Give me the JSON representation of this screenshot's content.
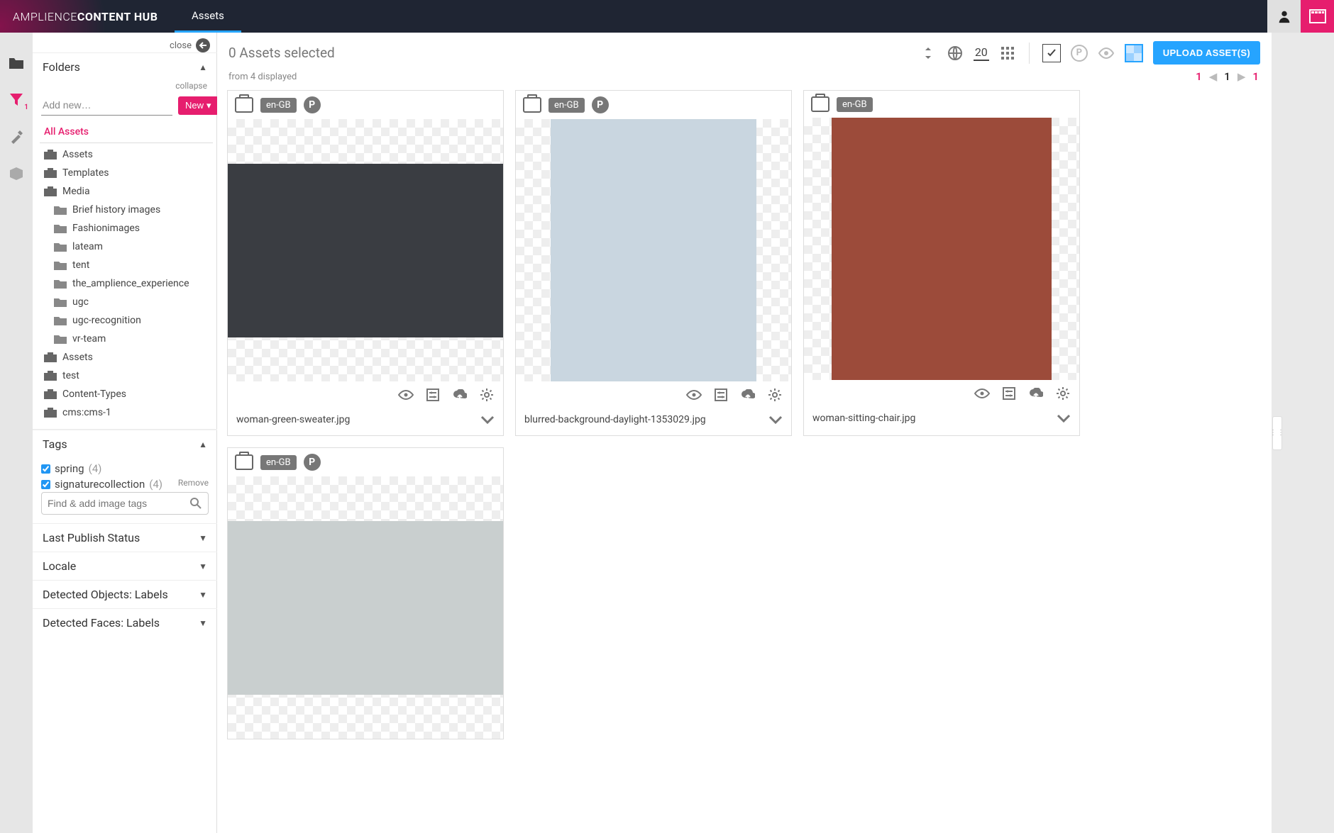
{
  "brand": {
    "light": "AMPLIENCE ",
    "bold": "CONTENT HUB"
  },
  "tab": {
    "assets": "Assets"
  },
  "sidebar": {
    "close": "close",
    "folders": {
      "title": "Folders",
      "collapse": "collapse",
      "placeholder": "Add new…",
      "newButton": "New"
    },
    "tree": {
      "allAssets": "All Assets",
      "items": [
        {
          "label": "Assets",
          "level": 1,
          "icon": "case"
        },
        {
          "label": "Templates",
          "level": 1,
          "icon": "case"
        },
        {
          "label": "Media",
          "level": 1,
          "icon": "case"
        },
        {
          "label": "Brief history images",
          "level": 2,
          "icon": "folder"
        },
        {
          "label": "Fashionimages",
          "level": 2,
          "icon": "folder"
        },
        {
          "label": "lateam",
          "level": 2,
          "icon": "folder"
        },
        {
          "label": "tent",
          "level": 2,
          "icon": "folder"
        },
        {
          "label": "the_amplience_experience",
          "level": 2,
          "icon": "folder"
        },
        {
          "label": "ugc",
          "level": 2,
          "icon": "folder"
        },
        {
          "label": "ugc-recognition",
          "level": 2,
          "icon": "folder"
        },
        {
          "label": "vr-team",
          "level": 2,
          "icon": "folder"
        },
        {
          "label": "Assets",
          "level": 1,
          "icon": "case"
        },
        {
          "label": "test",
          "level": 1,
          "icon": "case"
        },
        {
          "label": "Content-Types",
          "level": 1,
          "icon": "case"
        },
        {
          "label": "cms:cms-1",
          "level": 1,
          "icon": "case"
        }
      ]
    },
    "tags": {
      "title": "Tags",
      "items": [
        {
          "label": "spring",
          "count": "(4)",
          "checked": true
        },
        {
          "label": "signaturecollection",
          "count": "(4)",
          "checked": true
        }
      ],
      "remove": "Remove",
      "searchPlaceholder": "Find & add image tags"
    },
    "sections": {
      "lastPublish": "Last Publish Status",
      "locale": "Locale",
      "objects": "Detected Objects: Labels",
      "faces": "Detected Faces: Labels"
    }
  },
  "rail": {
    "filterBadge": "1"
  },
  "toolbar": {
    "selected": "0 Assets selected",
    "displayed": "from 4 displayed",
    "perPage": "20",
    "upload": "UPLOAD ASSET(S)"
  },
  "pager": {
    "first": "1",
    "current": "1",
    "last": "1"
  },
  "assets": [
    {
      "locale": "en-GB",
      "showP": true,
      "filename": "woman-green-sweater.jpg"
    },
    {
      "locale": "en-GB",
      "showP": true,
      "filename": "blurred-background-daylight-1353029.jpg"
    },
    {
      "locale": "en-GB",
      "showP": false,
      "filename": "woman-sitting-chair.jpg"
    },
    {
      "locale": "en-GB",
      "showP": true,
      "filename": ""
    }
  ]
}
